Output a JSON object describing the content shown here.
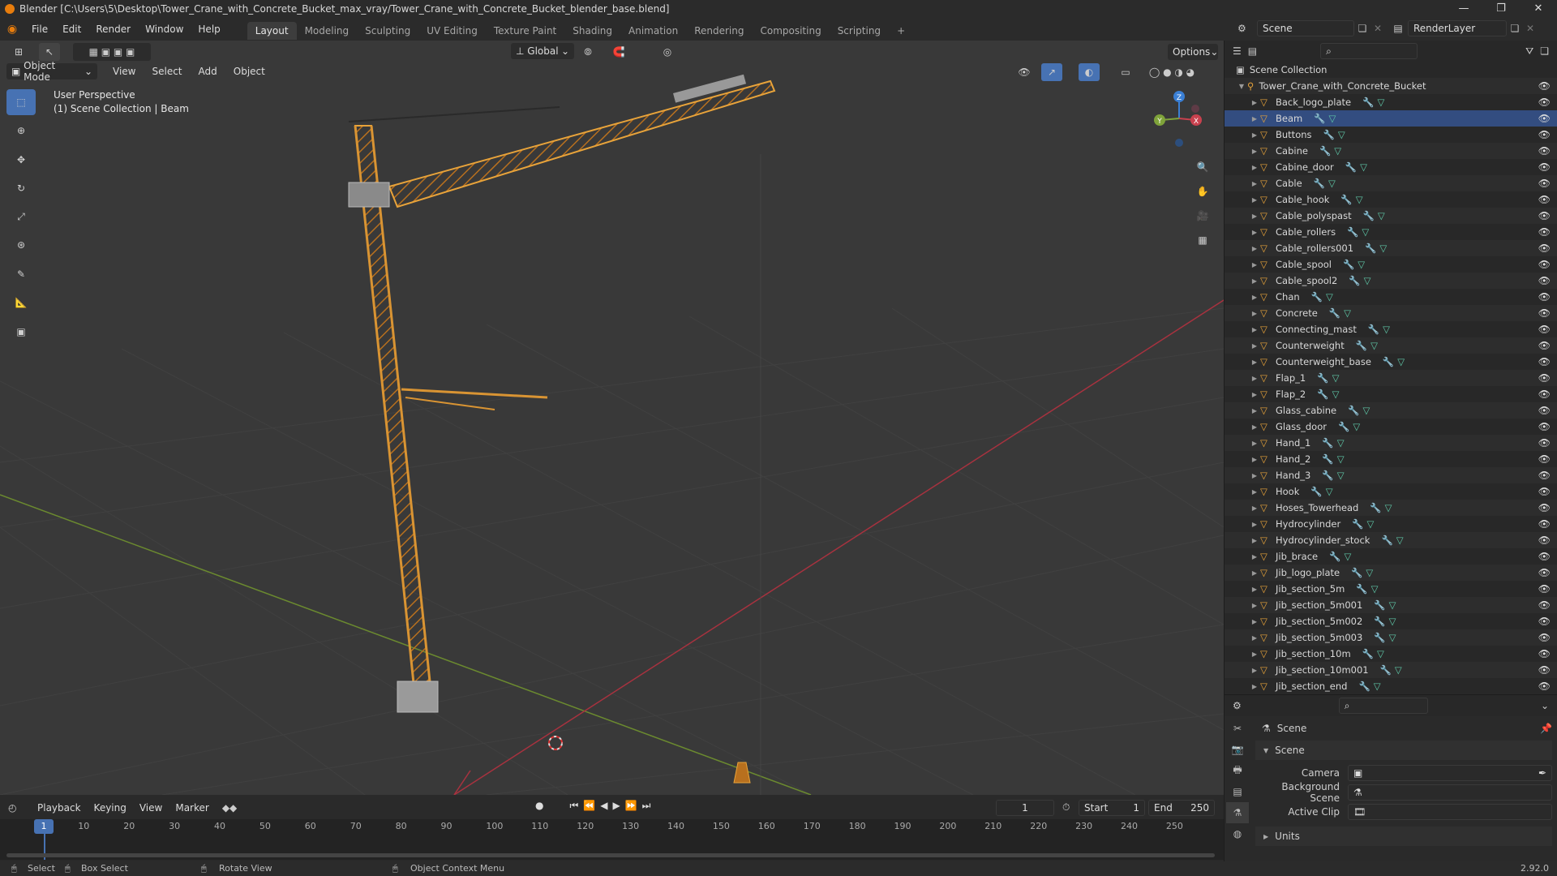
{
  "window": {
    "title": "Blender [C:\\Users\\5\\Desktop\\Tower_Crane_with_Concrete_Bucket_max_vray/Tower_Crane_with_Concrete_Bucket_blender_base.blend]"
  },
  "menu": [
    "File",
    "Edit",
    "Render",
    "Window",
    "Help"
  ],
  "workspaces": [
    "Layout",
    "Modeling",
    "Sculpting",
    "UV Editing",
    "Texture Paint",
    "Shading",
    "Animation",
    "Rendering",
    "Compositing",
    "Scripting"
  ],
  "scene": {
    "name": "Scene",
    "view_layer": "RenderLayer"
  },
  "viewport": {
    "transform_orientation": "Global",
    "options_label": "Options",
    "mode": "Object Mode",
    "view_menu": [
      "View",
      "Select",
      "Add",
      "Object"
    ],
    "overlay_line1": "User Perspective",
    "overlay_line2": "(1) Scene Collection | Beam",
    "gizmo_axes": {
      "z": "Z",
      "y": "Y",
      "x": "X"
    }
  },
  "timeline": {
    "menus": [
      "Playback",
      "Keying",
      "View",
      "Marker"
    ],
    "current_frame": "1",
    "start_label": "Start",
    "start": "1",
    "end_label": "End",
    "end": "250",
    "ruler": [
      "1",
      "10",
      "20",
      "30",
      "40",
      "50",
      "60",
      "70",
      "80",
      "90",
      "100",
      "110",
      "120",
      "130",
      "140",
      "150",
      "160",
      "170",
      "180",
      "190",
      "200",
      "210",
      "220",
      "230",
      "240",
      "250"
    ]
  },
  "statusbar": {
    "select": "Select",
    "box_select": "Box Select",
    "rotate": "Rotate View",
    "context": "Object Context Menu",
    "version": "2.92.0"
  },
  "outliner": {
    "root": "Scene Collection",
    "collection": "Tower_Crane_with_Concrete_Bucket",
    "objects": [
      "Back_logo_plate",
      "Beam",
      "Buttons",
      "Cabine",
      "Cabine_door",
      "Cable",
      "Cable_hook",
      "Cable_polyspast",
      "Cable_rollers",
      "Cable_rollers001",
      "Cable_spool",
      "Cable_spool2",
      "Chan",
      "Concrete",
      "Connecting_mast",
      "Counterweight",
      "Counterweight_base",
      "Flap_1",
      "Flap_2",
      "Glass_cabine",
      "Glass_door",
      "Hand_1",
      "Hand_2",
      "Hand_3",
      "Hook",
      "Hoses_Towerhead",
      "Hydrocylinder",
      "Hydrocylinder_stock",
      "Jib_brace",
      "Jib_logo_plate",
      "Jib_section_5m",
      "Jib_section_5m001",
      "Jib_section_5m002",
      "Jib_section_5m003",
      "Jib_section_10m",
      "Jib_section_10m001",
      "Jib_section_end"
    ],
    "active": "Beam"
  },
  "properties": {
    "context": "Scene",
    "panel": "Scene",
    "fields": [
      {
        "label": "Camera"
      },
      {
        "label": "Background Scene"
      },
      {
        "label": "Active Clip"
      }
    ],
    "subpanel": "Units"
  },
  "colors": {
    "accent": "#4772b3",
    "orange": "#e8a33a",
    "x_axis": "#c8414e",
    "y_axis": "#7fa33a",
    "z_axis": "#3a7fd5"
  }
}
